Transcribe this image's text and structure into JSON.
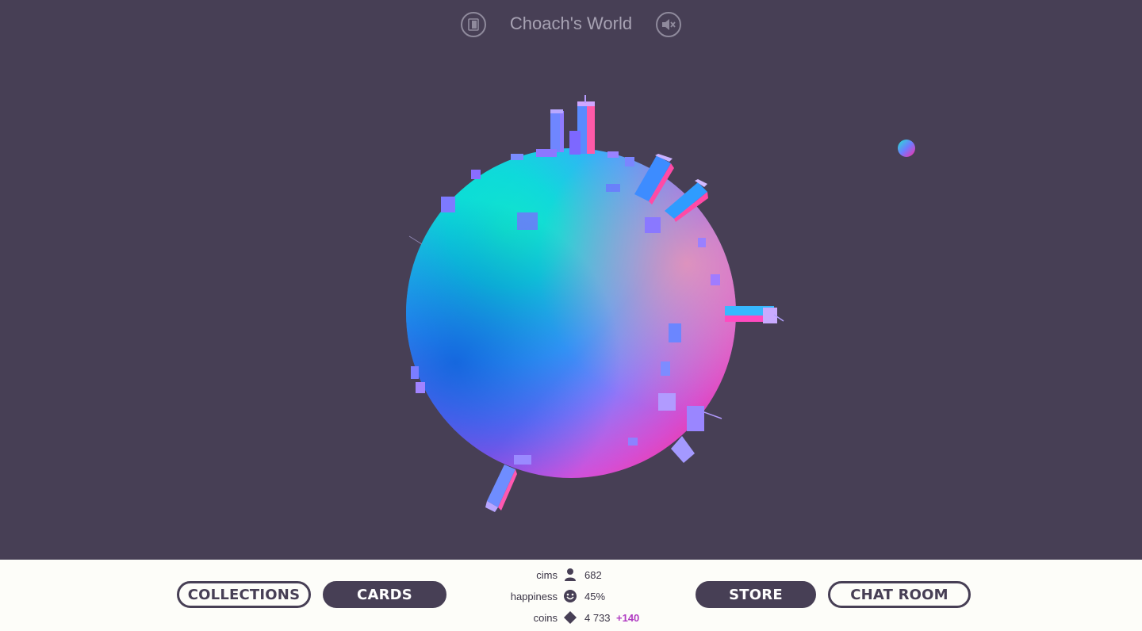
{
  "header": {
    "world_title": "Choach's World",
    "exit_icon": "exit-door-icon",
    "mute_icon": "speaker-muted-icon"
  },
  "footer": {
    "buttons": {
      "collections": "COLLECTIONS",
      "cards": "CARDS",
      "store": "STORE",
      "chat_room": "CHAT ROOM"
    },
    "stats": {
      "cims": {
        "label": "cims",
        "icon": "person-icon",
        "value": "682"
      },
      "happiness": {
        "label": "happiness",
        "icon": "smiley-icon",
        "value": "45%"
      },
      "coins": {
        "label": "coins",
        "icon": "diamond-icon",
        "value": "4 733",
        "delta": "+140"
      }
    }
  },
  "colors": {
    "background": "#473f55",
    "footer_bg": "#fdfdf9",
    "accent_delta": "#b03bc2",
    "button_dark": "#473f55"
  }
}
